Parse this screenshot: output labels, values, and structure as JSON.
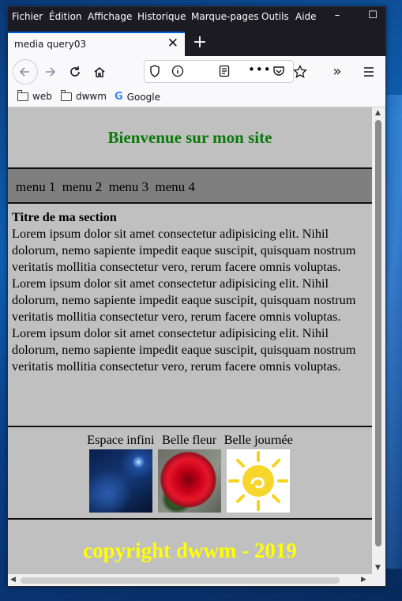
{
  "menubar": [
    "Fichier",
    "Édition",
    "Affichage",
    "Historique",
    "Marque-pages",
    "Outils",
    "Aide"
  ],
  "window_controls": {
    "minimize": "–",
    "maximize": "☐"
  },
  "tab": {
    "title": "media query03",
    "close": "✕",
    "new": "+"
  },
  "toolbar_icons": [
    "back-icon",
    "forward-icon",
    "reload-icon",
    "home-icon",
    "shield-icon",
    "info-icon",
    "reader-icon",
    "more-icon",
    "pocket-icon",
    "star-icon",
    "overflow-icon",
    "menu-icon"
  ],
  "bookmarks": [
    {
      "label": "web",
      "icon": "folder-icon"
    },
    {
      "label": "dwwm",
      "icon": "folder-icon"
    },
    {
      "label": "Google",
      "icon": "google-icon"
    }
  ],
  "page": {
    "header_title": "Bienvenue sur mon site",
    "nav": [
      "menu 1",
      "menu 2",
      "menu 3",
      "menu 4"
    ],
    "section_title": "Titre de ma section",
    "paragraphs": [
      "Lorem ipsum dolor sit amet consectetur adipisicing elit. Nihil dolorum, nemo sapiente impedit eaque suscipit, quisquam nostrum veritatis mollitia consectetur vero, rerum facere omnis voluptas.",
      "Lorem ipsum dolor sit amet consectetur adipisicing elit. Nihil dolorum, nemo sapiente impedit eaque suscipit, quisquam nostrum veritatis mollitia consectetur vero, rerum facere omnis voluptas.",
      "Lorem ipsum dolor sit amet consectetur adipisicing elit. Nihil dolorum, nemo sapiente impedit eaque suscipit, quisquam nostrum veritatis mollitia consectetur vero, rerum facere omnis voluptas."
    ],
    "gallery": [
      {
        "caption": "Espace infini"
      },
      {
        "caption": "Belle fleur"
      },
      {
        "caption": "Belle journée"
      }
    ],
    "footer": "copyright dwwm - 2019"
  },
  "colors": {
    "header_text": "#0a7a0a",
    "footer_text": "#ffff00",
    "page_bg": "#c0c0c0",
    "nav_bg": "#7f7f7f"
  }
}
